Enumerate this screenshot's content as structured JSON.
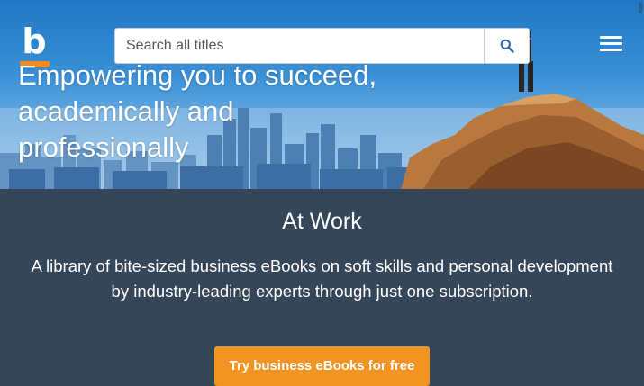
{
  "header": {
    "logo_letter": "b",
    "search": {
      "placeholder": "Search all titles",
      "button_icon": "search-icon"
    },
    "menu_icon": "hamburger-menu-icon"
  },
  "hero": {
    "headline_lines": [
      "Empowering you to succeed,",
      "academically and",
      "professionally"
    ]
  },
  "section": {
    "title": "At Work",
    "description": "A library of bite-sized business eBooks on soft skills and personal development by industry-leading experts through just one subscription.",
    "cta_label": "Try business eBooks for free"
  },
  "colors": {
    "accent_orange": "#f29422",
    "section_bg": "#354659",
    "sky_top": "#1f78c4"
  }
}
